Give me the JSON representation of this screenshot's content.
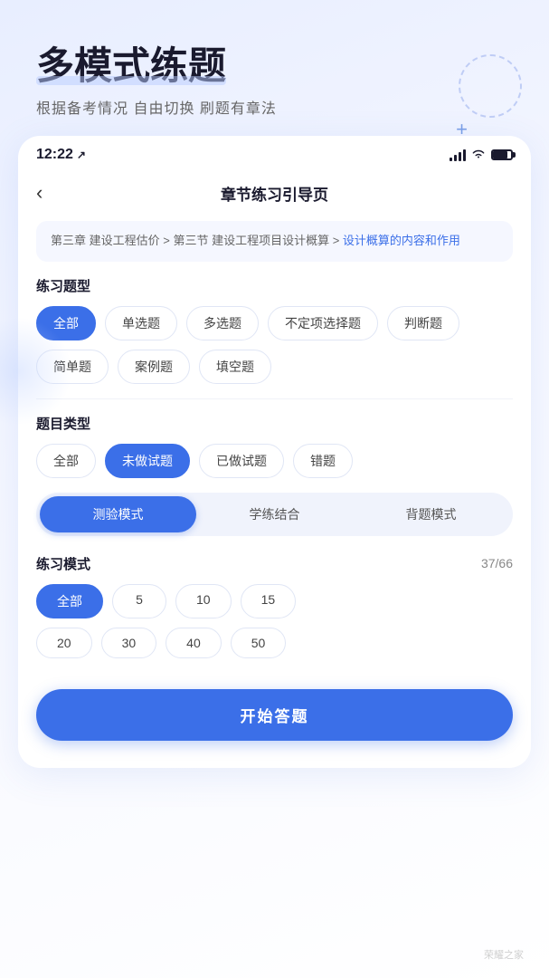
{
  "app": {
    "title": "多模式练题",
    "subtitle": "根据备考情况 自由切换 刷题有章法"
  },
  "status_bar": {
    "time": "12:22",
    "location_icon": "↗"
  },
  "nav": {
    "back_icon": "‹",
    "title": "章节练习引导页"
  },
  "breadcrumb": {
    "path1": "第三章 建设工程估价",
    "sep1": " > ",
    "path2": "第三节 建设工程项目设计概算",
    "sep2": " > ",
    "active": "设计概算的内容和作用"
  },
  "question_type": {
    "label": "练习题型",
    "tags": [
      {
        "id": "all",
        "label": "全部",
        "active": true
      },
      {
        "id": "single",
        "label": "单选题",
        "active": false
      },
      {
        "id": "multi",
        "label": "多选题",
        "active": false
      },
      {
        "id": "uncertain",
        "label": "不定项选择题",
        "active": false
      },
      {
        "id": "judge",
        "label": "判断题",
        "active": false
      },
      {
        "id": "simple",
        "label": "简单题",
        "active": false
      },
      {
        "id": "case",
        "label": "案例题",
        "active": false
      },
      {
        "id": "fill",
        "label": "填空题",
        "active": false
      }
    ]
  },
  "question_category": {
    "label": "题目类型",
    "tags": [
      {
        "id": "all",
        "label": "全部",
        "active": false
      },
      {
        "id": "not_done",
        "label": "未做试题",
        "active": true
      },
      {
        "id": "done",
        "label": "已做试题",
        "active": false
      },
      {
        "id": "wrong",
        "label": "错题",
        "active": false
      }
    ]
  },
  "mode_tabs": [
    {
      "id": "test",
      "label": "测验模式",
      "active": true
    },
    {
      "id": "study",
      "label": "学练结合",
      "active": false
    },
    {
      "id": "back",
      "label": "背题模式",
      "active": false
    }
  ],
  "practice_mode": {
    "label": "练习模式",
    "count": "37/66",
    "numbers": [
      {
        "id": "all",
        "label": "全部",
        "active": true
      },
      {
        "id": "5",
        "label": "5",
        "active": false
      },
      {
        "id": "10",
        "label": "10",
        "active": false
      },
      {
        "id": "15",
        "label": "15",
        "active": false
      },
      {
        "id": "20",
        "label": "20",
        "active": false
      },
      {
        "id": "30",
        "label": "30",
        "active": false
      },
      {
        "id": "40",
        "label": "40",
        "active": false
      },
      {
        "id": "50",
        "label": "50",
        "active": false
      }
    ]
  },
  "start_button": {
    "label": "开始答题"
  },
  "watermark": "荣耀之家"
}
